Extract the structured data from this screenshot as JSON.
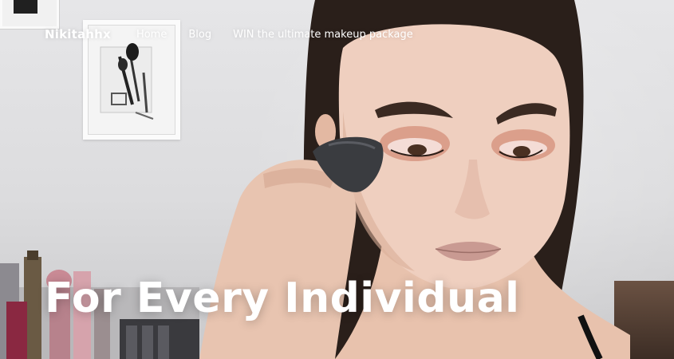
{
  "nav": {
    "brand": "Nikitahhx",
    "links": [
      {
        "label": "Home"
      },
      {
        "label": "Blog"
      },
      {
        "label": "WIN the ultimate makeup package"
      }
    ]
  },
  "hero": {
    "headline": "For Every Individual"
  },
  "colors": {
    "text": "#ffffff",
    "wall": "#dcdcde"
  }
}
